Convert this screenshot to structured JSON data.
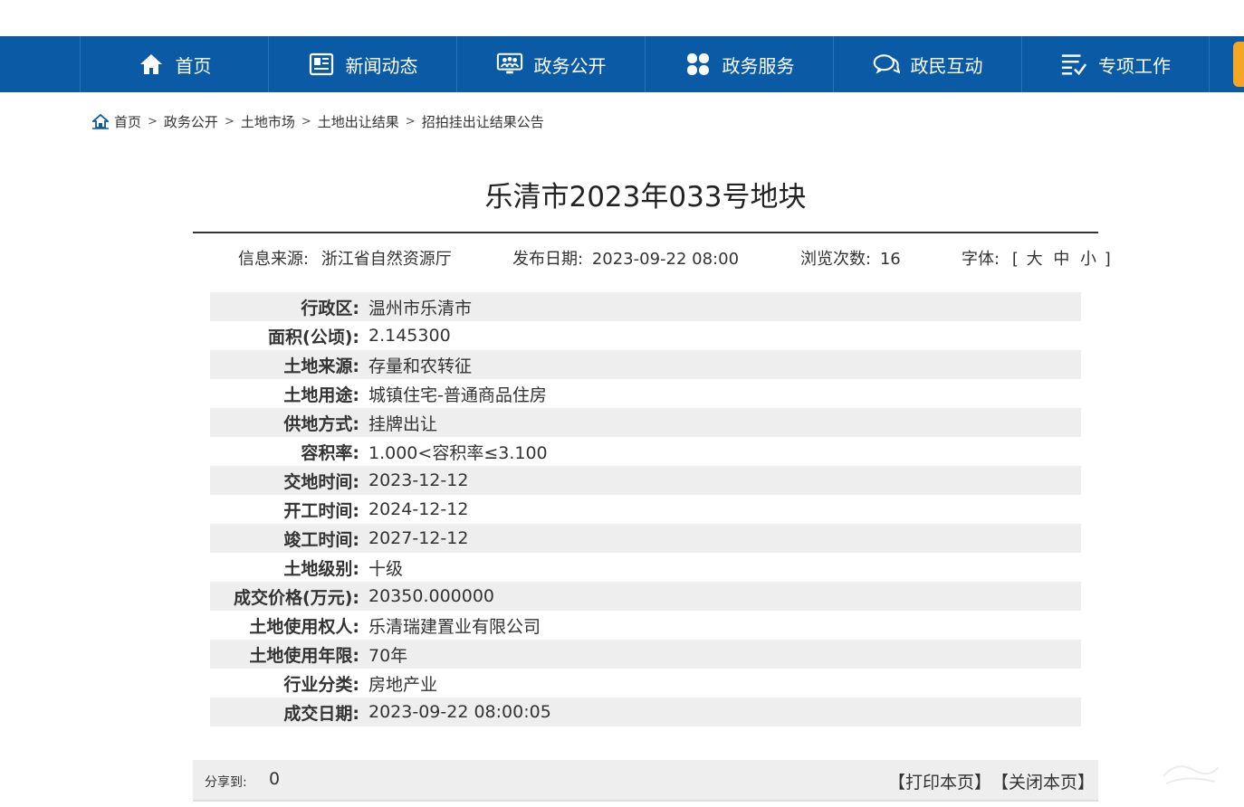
{
  "nav": {
    "items": [
      {
        "label": "首页",
        "icon": "home-icon"
      },
      {
        "label": "新闻动态",
        "icon": "newspaper-icon"
      },
      {
        "label": "政务公开",
        "icon": "monitor-people-icon"
      },
      {
        "label": "政务服务",
        "icon": "grid-icon"
      },
      {
        "label": "政民互动",
        "icon": "chat-icon"
      },
      {
        "label": "专项工作",
        "icon": "checklist-icon"
      }
    ]
  },
  "breadcrumb": {
    "icon": "home-icon",
    "separator": ">",
    "items": [
      "首页",
      "政务公开",
      "土地市场",
      "土地出让结果",
      "招拍挂出让结果公告"
    ]
  },
  "article": {
    "title": "乐清市2023年033号地块"
  },
  "meta": {
    "source_label": "信息来源:",
    "source": "浙江省自然资源厅",
    "date_label": "发布日期:",
    "date": "2023-09-22 08:00",
    "views_label": "浏览次数:",
    "views": "16",
    "font_label": "字体:",
    "bracket_open": "[",
    "font_large": "大",
    "font_medium": "中",
    "font_small": "小",
    "bracket_close": "]"
  },
  "details": [
    {
      "label": "行政区:",
      "value": "温州市乐清市"
    },
    {
      "label": "面积(公顷):",
      "value": "2.145300"
    },
    {
      "label": "土地来源:",
      "value": "存量和农转征"
    },
    {
      "label": "土地用途:",
      "value": "城镇住宅-普通商品住房"
    },
    {
      "label": "供地方式:",
      "value": "挂牌出让"
    },
    {
      "label": "容积率:",
      "value": "1.000<容积率≤3.100"
    },
    {
      "label": "交地时间:",
      "value": "2023-12-12"
    },
    {
      "label": "开工时间:",
      "value": "2024-12-12"
    },
    {
      "label": "竣工时间:",
      "value": "2027-12-12"
    },
    {
      "label": "土地级别:",
      "value": "十级"
    },
    {
      "label": "成交价格(万元):",
      "value": "20350.000000"
    },
    {
      "label": "土地使用权人:",
      "value": "乐清瑞建置业有限公司"
    },
    {
      "label": "土地使用年限:",
      "value": "70年"
    },
    {
      "label": "行业分类:",
      "value": "房地产业"
    },
    {
      "label": "成交日期:",
      "value": "2023-09-22 08:00:05"
    }
  ],
  "share": {
    "label": "分享到:",
    "count": "0",
    "print": "【打印本页】",
    "close": "【关闭本页】"
  },
  "colors": {
    "nav_bg": "#0a5aa5",
    "accent_orange": "#f5a623",
    "row_alt": "#eeeeee"
  }
}
